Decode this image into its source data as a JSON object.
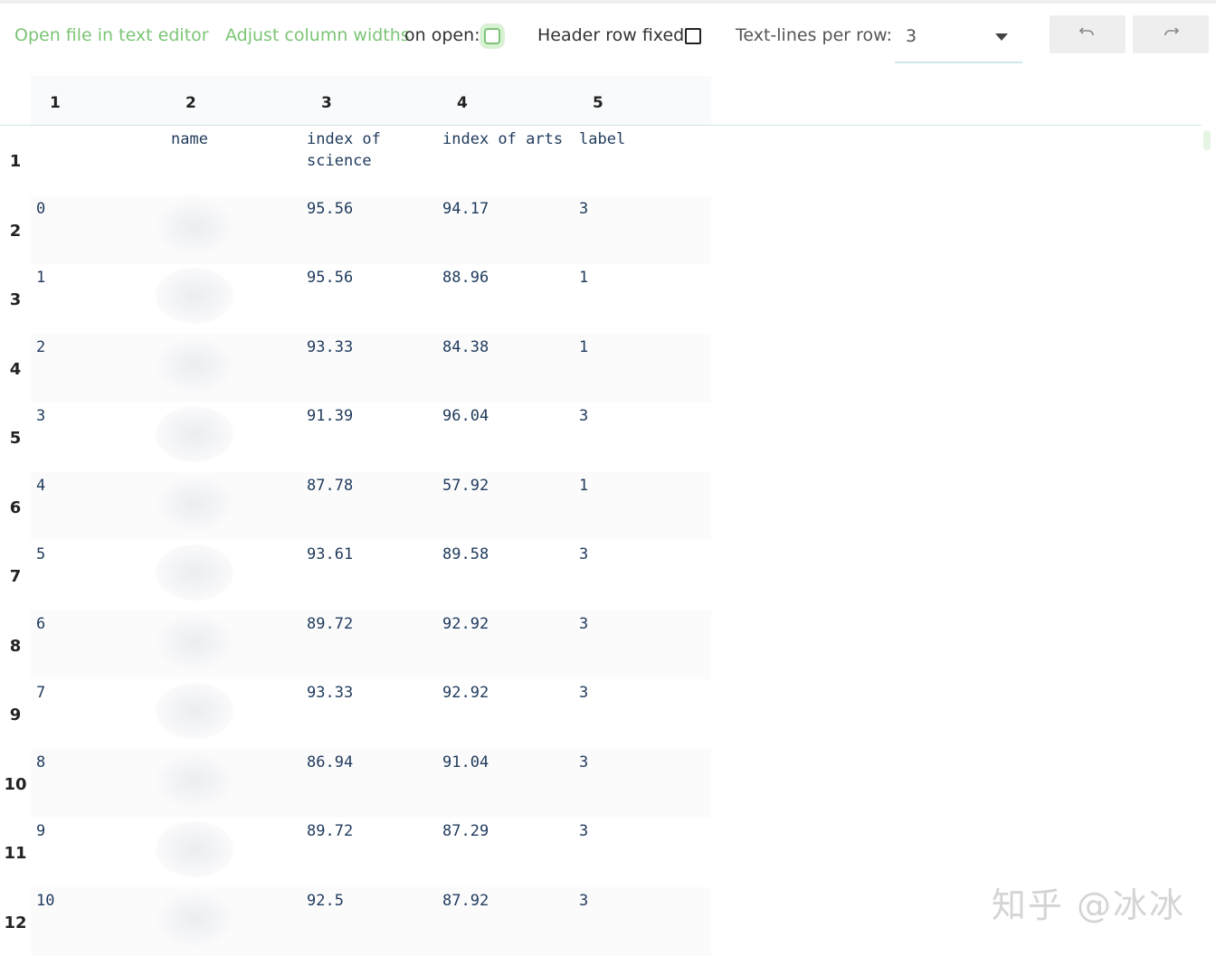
{
  "toolbar": {
    "open_file_label": "Open file in text editor",
    "adjust_widths_label": "Adjust column widths",
    "on_open_label": "on open:",
    "header_fixed_label": "Header row fixed:",
    "lines_per_row_label": "Text-lines per row:",
    "lines_per_row_value": "3",
    "undo_icon": "undo-icon",
    "redo_icon": "redo-icon"
  },
  "columns": [
    "1",
    "2",
    "3",
    "4",
    "5"
  ],
  "header": {
    "c1": "",
    "c2": "name",
    "c3": "index of\nscience",
    "c4": "index of arts",
    "c5": "label"
  },
  "rows": [
    {
      "n": "1"
    },
    {
      "n": "2",
      "c1": "0",
      "c3": "95.56",
      "c4": "94.17",
      "c5": "3"
    },
    {
      "n": "3",
      "c1": "1",
      "c3": "95.56",
      "c4": "88.96",
      "c5": "1"
    },
    {
      "n": "4",
      "c1": "2",
      "c3": "93.33",
      "c4": "84.38",
      "c5": "1"
    },
    {
      "n": "5",
      "c1": "3",
      "c3": "91.39",
      "c4": "96.04",
      "c5": "3"
    },
    {
      "n": "6",
      "c1": "4",
      "c3": "87.78",
      "c4": "57.92",
      "c5": "1"
    },
    {
      "n": "7",
      "c1": "5",
      "c3": "93.61",
      "c4": "89.58",
      "c5": "3"
    },
    {
      "n": "8",
      "c1": "6",
      "c3": "89.72",
      "c4": "92.92",
      "c5": "3"
    },
    {
      "n": "9",
      "c1": "7",
      "c3": "93.33",
      "c4": "92.92",
      "c5": "3"
    },
    {
      "n": "10",
      "c1": "8",
      "c3": "86.94",
      "c4": "91.04",
      "c5": "3"
    },
    {
      "n": "11",
      "c1": "9",
      "c3": "89.72",
      "c4": "87.29",
      "c5": "3"
    },
    {
      "n": "12",
      "c1": "10",
      "c3": "92.5",
      "c4": "87.92",
      "c5": "3"
    }
  ],
  "watermark": "知乎 @冰冰",
  "colors": {
    "link_green": "#7cc576",
    "cell_text": "#1f3a5c",
    "header_line": "#cfe7e7"
  }
}
